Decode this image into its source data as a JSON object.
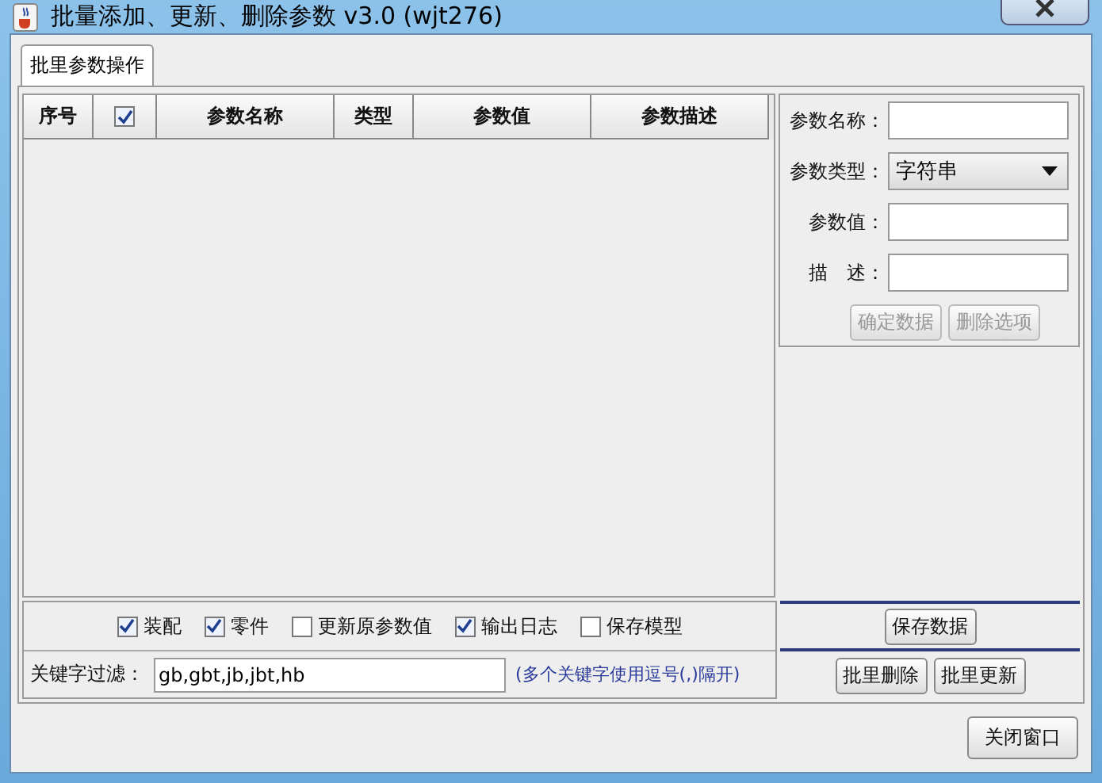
{
  "window": {
    "title": "批量添加、更新、删除参数 v3.0 (wjt276)"
  },
  "tabs": [
    {
      "label": "批里参数操作",
      "selected": true
    }
  ],
  "table": {
    "columns": [
      {
        "kind": "text",
        "label": "序号"
      },
      {
        "kind": "checkbox",
        "checked": true
      },
      {
        "kind": "text",
        "label": "参数名称"
      },
      {
        "kind": "text",
        "label": "类型"
      },
      {
        "kind": "text",
        "label": "参数值"
      },
      {
        "kind": "text",
        "label": "参数描述"
      }
    ]
  },
  "form": {
    "fields": [
      {
        "kind": "input",
        "label": "参数名称："
      },
      {
        "kind": "select",
        "label": "参数类型：",
        "value": "字符串"
      },
      {
        "kind": "input",
        "label": "参数值："
      },
      {
        "kind": "input",
        "label": "描　述："
      }
    ],
    "buttons": [
      {
        "label": "确定数据",
        "disabled": true
      },
      {
        "label": "删除选项",
        "disabled": true
      }
    ]
  },
  "options": [
    {
      "label": "装配",
      "checked": true
    },
    {
      "label": "零件",
      "checked": true
    },
    {
      "label": "更新原参数值",
      "checked": false
    },
    {
      "label": "输出日志",
      "checked": true
    },
    {
      "label": "保存模型",
      "checked": false
    }
  ],
  "filter": {
    "label": "关键字过滤：",
    "value": "gb,gbt,jb,jbt,hb",
    "hint": "(多个关键字使用逗号(,)隔开)"
  },
  "save_button": {
    "label": "保存数据"
  },
  "batch_buttons": [
    {
      "label": "批里删除"
    },
    {
      "label": "批里更新"
    }
  ],
  "close_button": {
    "label": "关闭窗口"
  }
}
